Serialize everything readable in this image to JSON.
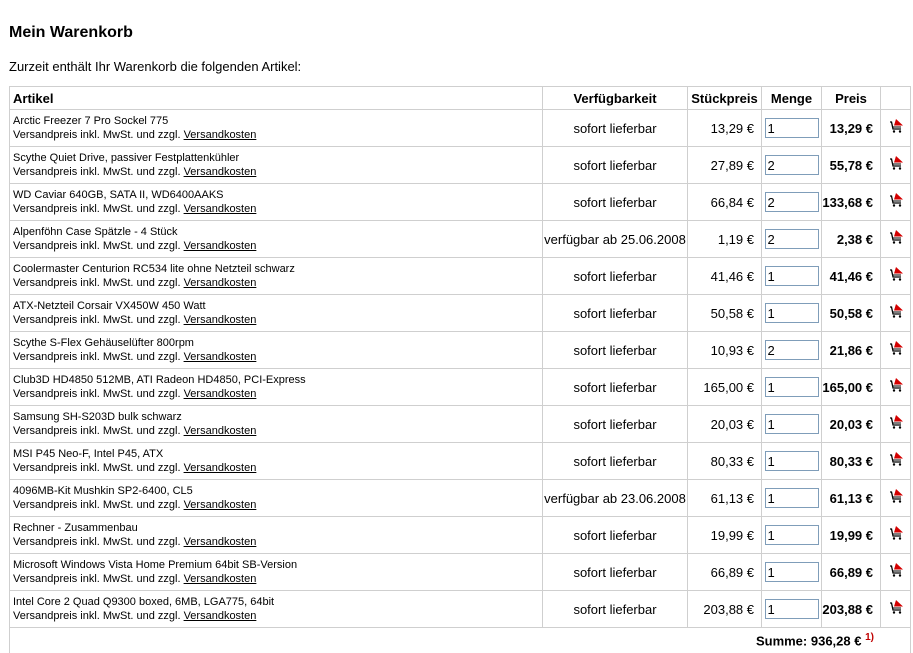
{
  "page": {
    "title": "Mein Warenkorb",
    "intro": "Zurzeit enthält Ihr Warenkorb die folgenden Artikel:"
  },
  "table": {
    "headers": {
      "artikel": "Artikel",
      "verfuegbarkeit": "Verfügbarkeit",
      "stueckpreis": "Stückpreis",
      "menge": "Menge",
      "preis": "Preis"
    },
    "shipping_prefix": "Versandpreis inkl. MwSt. und zzgl. ",
    "shipping_link": "Versandkosten",
    "delete_icon": "cart-remove-icon",
    "accent_color": "#d40000",
    "items": [
      {
        "name": "Arctic Freezer 7 Pro Sockel 775",
        "availability": "sofort lieferbar",
        "unit_price": "13,29 €",
        "qty": "1",
        "total": "13,29 €"
      },
      {
        "name": "Scythe Quiet Drive, passiver Festplattenkühler",
        "availability": "sofort lieferbar",
        "unit_price": "27,89 €",
        "qty": "2",
        "total": "55,78 €"
      },
      {
        "name": "WD Caviar 640GB, SATA II, WD6400AAKS",
        "availability": "sofort lieferbar",
        "unit_price": "66,84 €",
        "qty": "2",
        "total": "133,68 €"
      },
      {
        "name": "Alpenföhn Case Spätzle - 4 Stück",
        "availability": "verfügbar ab 25.06.2008",
        "unit_price": "1,19 €",
        "qty": "2",
        "total": "2,38 €"
      },
      {
        "name": "Coolermaster Centurion RC534 lite ohne Netzteil schwarz",
        "availability": "sofort lieferbar",
        "unit_price": "41,46 €",
        "qty": "1",
        "total": "41,46 €"
      },
      {
        "name": "ATX-Netzteil Corsair VX450W 450 Watt",
        "availability": "sofort lieferbar",
        "unit_price": "50,58 €",
        "qty": "1",
        "total": "50,58 €"
      },
      {
        "name": "Scythe S-Flex Gehäuselüfter 800rpm",
        "availability": "sofort lieferbar",
        "unit_price": "10,93 €",
        "qty": "2",
        "total": "21,86 €"
      },
      {
        "name": "Club3D HD4850 512MB, ATI Radeon HD4850, PCI-Express",
        "availability": "sofort lieferbar",
        "unit_price": "165,00 €",
        "qty": "1",
        "total": "165,00 €"
      },
      {
        "name": "Samsung SH-S203D bulk schwarz",
        "availability": "sofort lieferbar",
        "unit_price": "20,03 €",
        "qty": "1",
        "total": "20,03 €"
      },
      {
        "name": "MSI P45 Neo-F, Intel P45, ATX",
        "availability": "sofort lieferbar",
        "unit_price": "80,33 €",
        "qty": "1",
        "total": "80,33 €"
      },
      {
        "name": "4096MB-Kit Mushkin SP2-6400, CL5",
        "availability": "verfügbar ab 23.06.2008",
        "unit_price": "61,13 €",
        "qty": "1",
        "total": "61,13 €"
      },
      {
        "name": "Rechner - Zusammenbau",
        "availability": "sofort lieferbar",
        "unit_price": "19,99 €",
        "qty": "1",
        "total": "19,99 €"
      },
      {
        "name": "Microsoft Windows Vista Home Premium 64bit SB-Version",
        "availability": "sofort lieferbar",
        "unit_price": "66,89 €",
        "qty": "1",
        "total": "66,89 €"
      },
      {
        "name": "Intel Core 2 Quad Q9300 boxed, 6MB, LGA775, 64bit",
        "availability": "sofort lieferbar",
        "unit_price": "203,88 €",
        "qty": "1",
        "total": "203,88 €"
      }
    ],
    "sum_label": "Summe: 936,28 €",
    "sum_footnote": "1)"
  }
}
